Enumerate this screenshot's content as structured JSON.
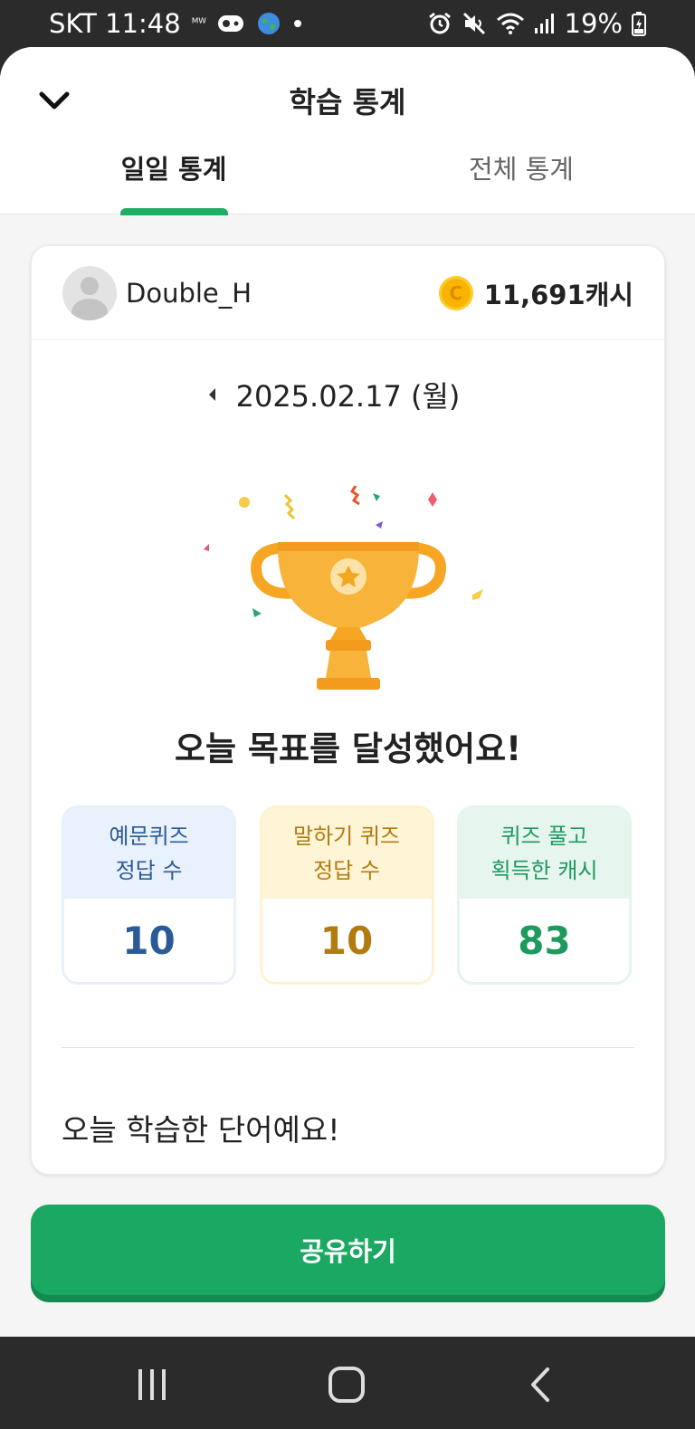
{
  "status_bar": {
    "carrier_time": "SKT 11:48",
    "small_label": "ᴹᵂ",
    "battery": "19%",
    "icons": [
      "messenger-icon",
      "globe-icon",
      "dot-icon",
      "alarm-icon",
      "mute-icon",
      "wifi-icon",
      "signal-icon",
      "battery-icon"
    ]
  },
  "header": {
    "title": "학습 통계",
    "back_icon": "chevron-down-icon"
  },
  "tabs": [
    {
      "label": "일일 통계",
      "active": true
    },
    {
      "label": "전체 통계",
      "active": false
    }
  ],
  "colors": {
    "accent": "#1aa862",
    "blue": "#2b5b96",
    "yellow": "#b27b10",
    "green": "#1e9a5f",
    "trophy": "#f6a623"
  },
  "profile": {
    "username": "Double_H",
    "coin_symbol": "C",
    "cash": "11,691캐시"
  },
  "date": {
    "text": "2025.02.17 (월)",
    "prev_icon": "caret-left-icon"
  },
  "goal_message": "오늘 목표를 달성했어요!",
  "stats": [
    {
      "line1": "예문퀴즈",
      "line2": "정답 수",
      "value": "10"
    },
    {
      "line1": "말하기 퀴즈",
      "line2": "정답 수",
      "value": "10"
    },
    {
      "line1": "퀴즈 풀고",
      "line2": "획득한 캐시",
      "value": "83"
    }
  ],
  "words_title": "오늘 학습한 단어예요!",
  "share_button": "공유하기",
  "nav": [
    "recent-apps-icon",
    "home-icon",
    "back-icon"
  ]
}
